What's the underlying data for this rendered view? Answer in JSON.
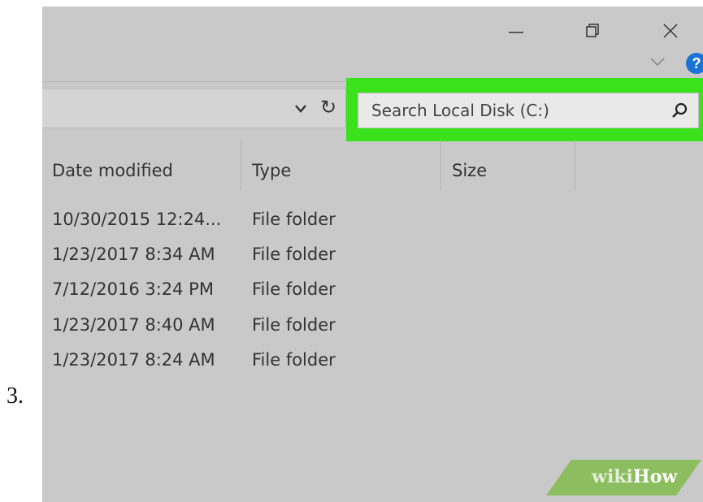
{
  "step": {
    "number": "3."
  },
  "window_controls": {
    "minimize_icon": "minimize-icon",
    "maximize_icon": "restore-icon",
    "close_icon": "close-icon"
  },
  "ribbon": {
    "collapse_icon": "chevron-down-icon",
    "help_label": "?"
  },
  "address_bar": {
    "dropdown_icon": "chevron-down-icon",
    "refresh_label": "↻"
  },
  "search": {
    "placeholder": "Search Local Disk (C:)",
    "icon": "search-icon",
    "highlight_color": "#39e21b"
  },
  "columns": {
    "date_modified": "Date modified",
    "type": "Type",
    "size": "Size"
  },
  "rows": [
    {
      "date": "10/30/2015 12:24...",
      "type": "File folder",
      "size": ""
    },
    {
      "date": "1/23/2017 8:34 AM",
      "type": "File folder",
      "size": ""
    },
    {
      "date": "7/12/2016 3:24 PM",
      "type": "File folder",
      "size": ""
    },
    {
      "date": "1/23/2017 8:40 AM",
      "type": "File folder",
      "size": ""
    },
    {
      "date": "1/23/2017 8:24 AM",
      "type": "File folder",
      "size": ""
    }
  ],
  "watermark": {
    "wiki": "wiki",
    "how": "How"
  }
}
